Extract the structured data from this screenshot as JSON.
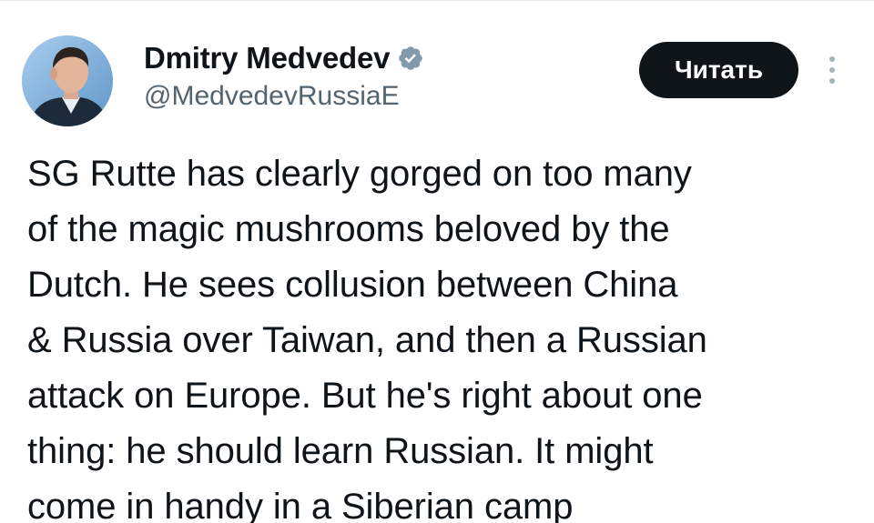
{
  "author": {
    "display_name": "Dmitry Medvedev",
    "handle": "@MedvedevRussiaE",
    "verified": true,
    "avatar_icon": "profile-photo"
  },
  "actions": {
    "read_label": "Читать",
    "more_icon": "more-vertical-icon"
  },
  "tweet": {
    "text": "SG Rutte has clearly gorged on too many\nof the magic mushrooms beloved by the\nDutch. He sees collusion between China\n& Russia over Taiwan, and then a Russian\nattack on Europe. But he's right about one\nthing: he should learn Russian. It might\ncome in handy in a Siberian camp"
  },
  "colors": {
    "verified_badge": "#829aab",
    "button_bg": "#0f1419",
    "secondary_text": "#536471"
  }
}
